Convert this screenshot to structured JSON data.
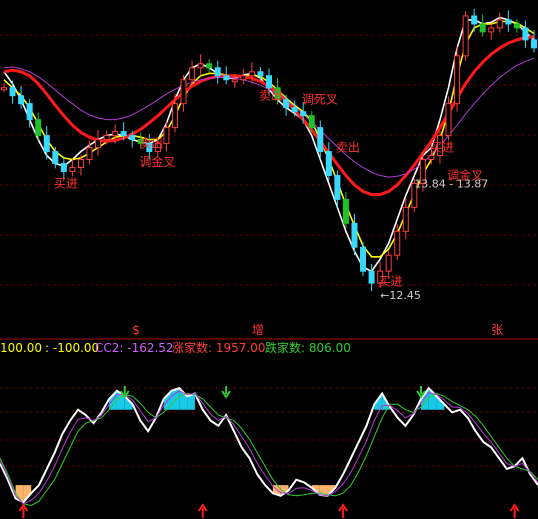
{
  "chart_data": [
    {
      "type": "candlestick",
      "title": "",
      "ylim": [
        12.0,
        16.2
      ],
      "grid": true,
      "colors": {
        "up": "#ff3b3b",
        "up_body_hollow": true,
        "down": "#38d8ff",
        "down_alt": "#21c12a",
        "ma_white": "#ffffff",
        "ma_yellow": "#ffff00",
        "ma_red": "#ff1a1a",
        "ma_purple": "#b23ad6"
      },
      "candles_close": [
        15.1,
        15.0,
        14.9,
        14.7,
        14.5,
        14.3,
        14.15,
        14.05,
        14.1,
        14.2,
        14.35,
        14.45,
        14.5,
        14.55,
        14.5,
        14.45,
        14.4,
        14.3,
        14.4,
        14.6,
        14.9,
        15.2,
        15.35,
        15.4,
        15.35,
        15.25,
        15.2,
        15.2,
        15.25,
        15.3,
        15.25,
        15.1,
        14.95,
        14.85,
        14.8,
        14.75,
        14.6,
        14.3,
        14.0,
        13.7,
        13.4,
        13.1,
        12.8,
        12.65,
        12.8,
        13.0,
        13.3,
        13.6,
        13.9,
        14.2,
        14.25,
        14.5,
        14.9,
        15.5,
        16.0,
        15.9,
        15.8,
        15.85,
        15.95,
        15.9,
        15.85,
        15.7,
        15.6
      ],
      "series": [
        {
          "name": "",
          "color": "white",
          "values": [
            15.3,
            15.15,
            14.95,
            14.7,
            14.45,
            14.25,
            14.15,
            14.12,
            14.2,
            14.3,
            14.38,
            14.45,
            14.5,
            14.52,
            14.5,
            14.45,
            14.42,
            14.4,
            14.45,
            14.65,
            14.95,
            15.2,
            15.35,
            15.4,
            15.35,
            15.28,
            15.22,
            15.22,
            15.26,
            15.28,
            15.22,
            15.08,
            14.95,
            14.85,
            14.78,
            14.7,
            14.5,
            14.2,
            13.9,
            13.6,
            13.3,
            13.05,
            12.85,
            12.8,
            12.95,
            13.15,
            13.45,
            13.75,
            14.0,
            14.25,
            14.35,
            14.7,
            15.1,
            15.6,
            15.95,
            15.95,
            15.9,
            15.92,
            15.98,
            15.95,
            15.9,
            15.8,
            15.7
          ]
        },
        {
          "name": "",
          "color": "yellow",
          "values": [
            15.2,
            15.1,
            15.0,
            14.85,
            14.65,
            14.45,
            14.3,
            14.22,
            14.2,
            14.22,
            14.28,
            14.35,
            14.42,
            14.48,
            14.5,
            14.5,
            14.48,
            14.45,
            14.45,
            14.55,
            14.75,
            14.98,
            15.15,
            15.25,
            15.28,
            15.28,
            15.26,
            15.24,
            15.25,
            15.26,
            15.24,
            15.17,
            15.07,
            14.97,
            14.88,
            14.8,
            14.68,
            14.45,
            14.2,
            13.92,
            13.63,
            13.37,
            13.12,
            12.98,
            12.98,
            13.08,
            13.27,
            13.52,
            13.77,
            14.02,
            14.2,
            14.45,
            14.8,
            15.25,
            15.65,
            15.85,
            15.9,
            15.9,
            15.93,
            15.93,
            15.91,
            15.85,
            15.78
          ]
        },
        {
          "name": "",
          "color": "red",
          "values": [
            15.3,
            15.32,
            15.3,
            15.25,
            15.15,
            15.02,
            14.88,
            14.75,
            14.63,
            14.54,
            14.48,
            14.44,
            14.43,
            14.44,
            14.47,
            14.52,
            14.58,
            14.66,
            14.75,
            14.85,
            14.95,
            15.04,
            15.12,
            15.18,
            15.22,
            15.24,
            15.25,
            15.25,
            15.24,
            15.22,
            15.18,
            15.12,
            15.04,
            14.94,
            14.82,
            14.7,
            14.57,
            14.43,
            14.28,
            14.14,
            14.0,
            13.88,
            13.8,
            13.76,
            13.76,
            13.8,
            13.88,
            14.0,
            14.13,
            14.28,
            14.43,
            14.6,
            14.78,
            14.97,
            15.15,
            15.3,
            15.42,
            15.52,
            15.6,
            15.66,
            15.7,
            15.73,
            15.74
          ]
        },
        {
          "name": "",
          "color": "purple",
          "values": [
            15.35,
            15.36,
            15.34,
            15.3,
            15.24,
            15.16,
            15.07,
            14.98,
            14.9,
            14.82,
            14.76,
            14.72,
            14.7,
            14.7,
            14.72,
            14.76,
            14.82,
            14.88,
            14.95,
            15.02,
            15.08,
            15.13,
            15.17,
            15.2,
            15.22,
            15.23,
            15.23,
            15.22,
            15.2,
            15.17,
            15.13,
            15.08,
            15.02,
            14.94,
            14.86,
            14.77,
            14.67,
            14.57,
            14.46,
            14.36,
            14.26,
            14.17,
            14.1,
            14.04,
            14.0,
            13.98,
            13.99,
            14.02,
            14.08,
            14.16,
            14.26,
            14.37,
            14.5,
            14.63,
            14.77,
            14.9,
            15.02,
            15.13,
            15.23,
            15.31,
            15.38,
            15.43,
            15.47
          ]
        }
      ],
      "annotations": [
        {
          "text": "买进",
          "x": 7,
          "y": 13.85,
          "color": "#ff3030"
        },
        {
          "text": "卖出",
          "x": 17,
          "y": 14.35,
          "color": "#ff3030"
        },
        {
          "text": "调金叉",
          "x": 17,
          "y": 14.12,
          "color": "#ff3030"
        },
        {
          "text": "卖出",
          "x": 31,
          "y": 14.95,
          "color": "#ff3030"
        },
        {
          "text": "调死叉",
          "x": 36,
          "y": 14.9,
          "color": "#ff3030"
        },
        {
          "text": "卖出",
          "x": 40,
          "y": 14.3,
          "color": "#ff3030"
        },
        {
          "text": "买进",
          "x": 45,
          "y": 12.62,
          "color": "#ff3030"
        },
        {
          "text": "买进",
          "x": 51,
          "y": 14.3,
          "color": "#ff3030"
        },
        {
          "text": "调金叉",
          "x": 53,
          "y": 13.95,
          "color": "#ff3030"
        }
      ],
      "price_labels": [
        {
          "text": "13.84 - 13.87",
          "x": 48,
          "y": 13.85
        },
        {
          "text": "←12.45",
          "x": 44,
          "y": 12.45
        }
      ],
      "bottom_marks": [
        {
          "text": "$",
          "x": 15
        },
        {
          "text": "增",
          "x": 29
        },
        {
          "text": "张",
          "x": 57
        }
      ]
    },
    {
      "type": "line",
      "title": "",
      "ylim": [
        -130,
        130
      ],
      "grid": true,
      "header": {
        "left_value": "100.00",
        "second_value": ": -100.00",
        "cc2": "CC2: -162.52",
        "zhang": "涨家数: 1957.00",
        "die": "跌家数: 806.00"
      },
      "header_colors": {
        "left": "#ffff00",
        "cc2": "#d25cff",
        "zhang": "#ff3b3b",
        "die": "#2ecc2e"
      },
      "series": [
        {
          "name": "",
          "color": "white",
          "values": [
            -40,
            -70,
            -105,
            -112,
            -95,
            -80,
            -50,
            -20,
            15,
            40,
            60,
            50,
            35,
            55,
            80,
            95,
            85,
            70,
            40,
            20,
            45,
            80,
            95,
            100,
            85,
            90,
            60,
            40,
            30,
            50,
            20,
            -10,
            -30,
            -60,
            -80,
            -95,
            -100,
            -90,
            -70,
            -75,
            -85,
            -98,
            -100,
            -85,
            -60,
            -30,
            0,
            30,
            70,
            90,
            65,
            45,
            30,
            50,
            80,
            100,
            85,
            70,
            55,
            60,
            45,
            20,
            0,
            -10,
            -30,
            -50,
            -45,
            -30,
            -60,
            -80
          ]
        },
        {
          "name": "",
          "color": "green",
          "values": [
            -30,
            -60,
            -95,
            -115,
            -118,
            -110,
            -90,
            -70,
            -40,
            -10,
            20,
            35,
            40,
            45,
            60,
            80,
            88,
            85,
            72,
            55,
            45,
            55,
            70,
            85,
            90,
            88,
            80,
            65,
            50,
            45,
            40,
            25,
            5,
            -20,
            -45,
            -70,
            -88,
            -98,
            -100,
            -98,
            -95,
            -95,
            -98,
            -100,
            -95,
            -80,
            -55,
            -25,
            10,
            45,
            70,
            70,
            60,
            55,
            65,
            82,
            90,
            85,
            75,
            68,
            60,
            48,
            30,
            10,
            -10,
            -30,
            -45,
            -50,
            -55,
            -70
          ]
        },
        {
          "name": "",
          "color": "purple",
          "values": [
            -35,
            -65,
            -100,
            -115,
            -108,
            -95,
            -72,
            -45,
            -12,
            18,
            42,
            45,
            40,
            50,
            70,
            88,
            88,
            78,
            58,
            38,
            45,
            68,
            85,
            95,
            88,
            90,
            72,
            52,
            40,
            48,
            32,
            10,
            -12,
            -40,
            -62,
            -82,
            -94,
            -96,
            -86,
            -85,
            -90,
            -98,
            -100,
            -92,
            -78,
            -56,
            -28,
            2,
            40,
            68,
            68,
            58,
            45,
            52,
            72,
            92,
            88,
            78,
            65,
            64,
            53,
            35,
            16,
            0,
            -20,
            -40,
            -45,
            -40,
            -57,
            -75
          ]
        }
      ],
      "signals": [
        {
          "type": "sell",
          "x": 16
        },
        {
          "type": "sell",
          "x": 29
        },
        {
          "type": "sell",
          "x": 54
        },
        {
          "type": "buy",
          "x": 3
        },
        {
          "type": "buy",
          "x": 26
        },
        {
          "type": "buy",
          "x": 44
        },
        {
          "type": "buy",
          "x": 66
        }
      ]
    }
  ]
}
